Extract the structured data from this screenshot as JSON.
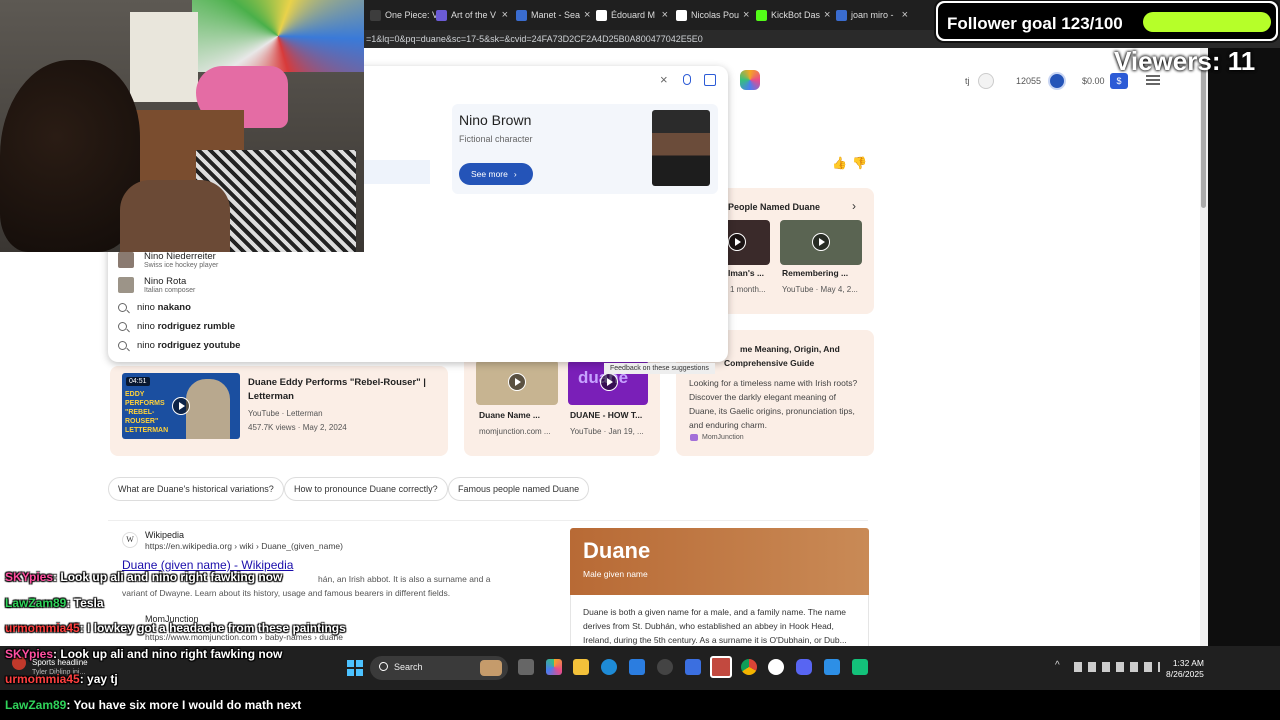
{
  "browser": {
    "tabs": [
      {
        "label": "One Piece: V",
        "color": "#3d3d3d"
      },
      {
        "label": "Art of the V",
        "color": "#6b5bd6"
      },
      {
        "label": "Manet - Sea",
        "color": "#3a6ccf"
      },
      {
        "label": "Édouard M",
        "color": "#ffffff"
      },
      {
        "label": "Nicolas Pou",
        "color": "#ffffff"
      },
      {
        "label": "KickBot Das",
        "color": "#53fc18"
      },
      {
        "label": "joan miro -",
        "color": "#3a6ccf"
      }
    ],
    "url": "=1&lq=0&pq=duane&sc=17-5&sk=&cvid=24FA73D2CF2A4D25B0A800477042E5E0"
  },
  "header": {
    "user": "tj",
    "points": "12055",
    "balance": "$0.00"
  },
  "entity_card": {
    "name": "Nino Brown",
    "subtitle": "Fictional character",
    "button": "See more"
  },
  "suggestions": [
    {
      "kind": "person",
      "name": "Nino Niederreiter",
      "desc": "Swiss ice hockey player"
    },
    {
      "kind": "person",
      "name": "Nino Rota",
      "desc": "Italian composer"
    },
    {
      "kind": "query",
      "prefix": "nino ",
      "bold": "nakano"
    },
    {
      "kind": "query",
      "prefix": "nino ",
      "bold": "rodriguez rumble"
    },
    {
      "kind": "query",
      "prefix": "nino ",
      "bold": "rodriguez youtube"
    }
  ],
  "feedback_link": "Feedback on these suggestions",
  "people_named": {
    "title": "People Named Duane",
    "videos": [
      {
        "title": "lman's ...",
        "meta": "1 month..."
      },
      {
        "title": "Remembering ...",
        "meta": "YouTube · May 4, 2..."
      }
    ]
  },
  "video_result": {
    "duration": "04:51",
    "thumb_text": "EDDY PERFORMS \"REBEL-ROUSER\" LETTERMAN",
    "title": "Duane Eddy Performs \"Rebel-Rouser\" | Letterman",
    "source": "YouTube",
    "channel": "Letterman",
    "meta": "457.7K views · May 2, 2024"
  },
  "name_videos": [
    {
      "title": "Duane Name ...",
      "meta": "momjunction.com ..."
    },
    {
      "title": "DUANE - HOW T...",
      "meta": "YouTube · Jan 19, ...",
      "thumb_text": "duane"
    }
  ],
  "meaning_card": {
    "title_line1": "me Meaning, Origin, And",
    "title_line2": "Comprehensive Guide",
    "body": "Looking for a timeless name with Irish roots? Discover the darkly elegant meaning of Duane, its Gaelic origins, pronunciation tips, and enduring charm.",
    "source": "MomJunction"
  },
  "chips": [
    "What are Duane's historical variations?",
    "How to pronounce Duane correctly?",
    "Famous people named Duane"
  ],
  "wiki_result": {
    "site": "Wikipedia",
    "url": "https://en.wikipedia.org › wiki › Duane_(given_name)",
    "title": "Duane (given name) - Wikipedia",
    "snippet_line1": "hán, an Irish abbot. It is also a surname and a",
    "snippet_line2": "variant of Dwayne. Learn about its history, usage and famous bearers in different fields.",
    "next_site": "MomJunction",
    "next_url": "https://www.momjunction.com › baby-names › duane"
  },
  "knowledge_panel": {
    "title": "Duane",
    "subtitle": "Male given name",
    "body": "Duane is both a given name for a male, and a family name. The name derives from St. Dubhán, who established an abbey in Hook Head, Ireland, during the 5th century. As a surname it is O'Dubhain, or Dub..."
  },
  "stream": {
    "goal": "Follower goal 123/100",
    "goal_progress": 1.0,
    "viewers": "Viewers: 11",
    "chat": [
      {
        "user": "SKYpies",
        "color": "#ff4fa0",
        "msg": "Look up ali and nino right fawking now"
      },
      {
        "user": "LawZam89",
        "color": "#2fd35a",
        "msg": "Tesla"
      },
      {
        "user": "urmommia45",
        "color": "#ff4040",
        "msg": "I lowkey got a headache from these paintings"
      },
      {
        "user": "SKYpies",
        "color": "#ff4fa0",
        "msg": "Look up ali and nino right fawking now"
      },
      {
        "user": "urmommia45",
        "color": "#ff4040",
        "msg": "yay tj"
      },
      {
        "user": "LawZam89",
        "color": "#2fd35a",
        "msg": "You have six more I would do math next"
      }
    ]
  },
  "taskbar": {
    "search": "Search",
    "time": "1:32 AM",
    "date": "8/26/2025",
    "widget_title": "Sports headline",
    "widget_sub": "Tyler Dibling inj..."
  }
}
